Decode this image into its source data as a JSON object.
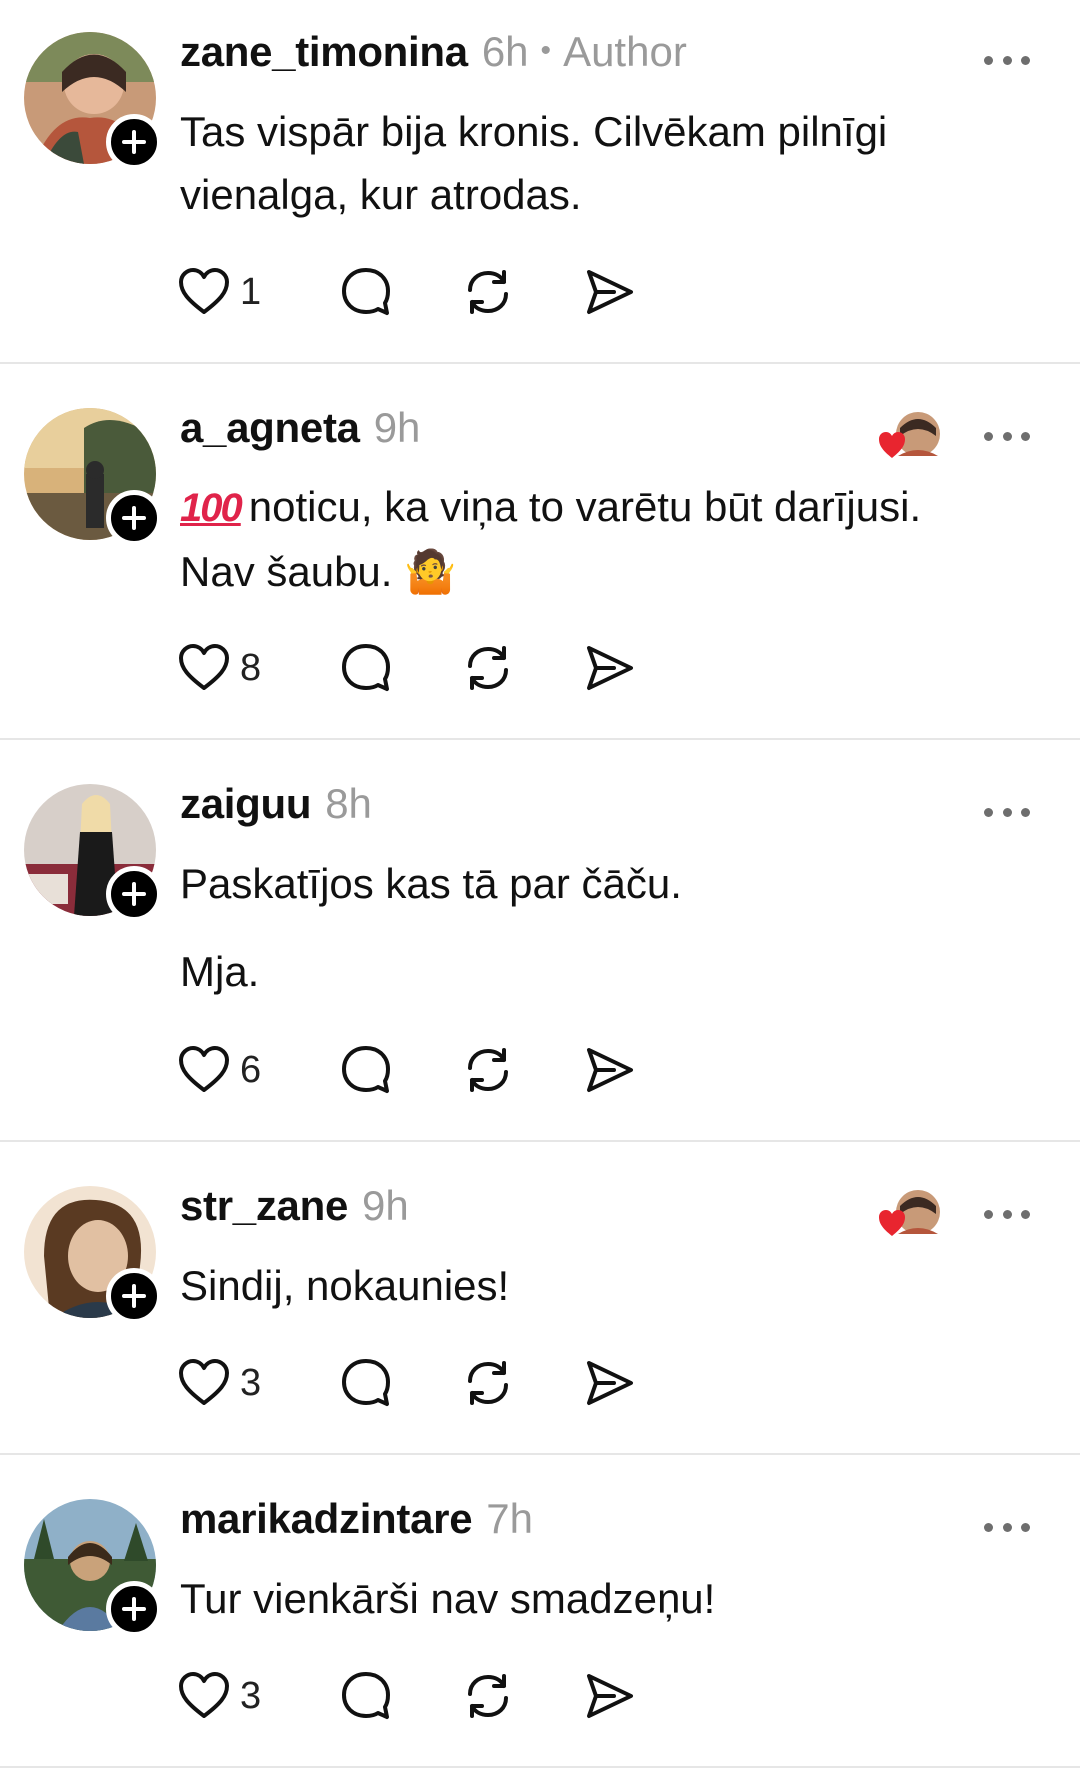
{
  "posts": [
    {
      "username": "zane_timonina",
      "time": "6h",
      "badge": "Author",
      "lines": [
        "Tas vispār bija kronis. Cilvēkam pilnīgi",
        "vienalga, kur atrodas."
      ],
      "likes": "1",
      "liked_by_author": false,
      "avatar_colors": [
        "#c89a78",
        "#3b4a3a",
        "#b5563c"
      ]
    },
    {
      "username": "a_agneta",
      "time": "9h",
      "lines": [
        "noticu, ka viņa to varētu būt darījusi.",
        "Nav šaubu."
      ],
      "prefix_emoji": "100",
      "suffix_emoji": "🤷",
      "likes": "8",
      "liked_by_author": true,
      "avatar_colors": [
        "#d8b27a",
        "#4a5a3a",
        "#2b2b2b"
      ]
    },
    {
      "username": "zaiguu",
      "time": "8h",
      "lines": [
        "Paskatījos kas tā par čāču."
      ],
      "extra_paragraph": "Mja.",
      "likes": "6",
      "liked_by_author": false,
      "avatar_colors": [
        "#d7cfc9",
        "#1a1a1a",
        "#8a2c3a"
      ]
    },
    {
      "username": "str_zane",
      "time": "9h",
      "lines": [
        "Sindij, nokaunies!"
      ],
      "likes": "3",
      "liked_by_author": true,
      "avatar_colors": [
        "#e1c0a2",
        "#5a3a22",
        "#f2e3d2"
      ]
    },
    {
      "username": "marikadzintare",
      "time": "7h",
      "lines": [
        "Tur vienkārši nav smadzeņu!"
      ],
      "likes": "3",
      "liked_by_author": false,
      "avatar_colors": [
        "#8fb0c8",
        "#3f5a35",
        "#c9a27a"
      ]
    }
  ],
  "icons": {
    "like": "heart-outline-icon",
    "reply": "speech-bubble-icon",
    "repost": "repost-arrows-icon",
    "share": "send-icon",
    "more": "more-dots-icon",
    "follow": "plus-icon",
    "liked_by": "heart-filled-icon"
  },
  "colors": {
    "text": "#111111",
    "muted": "#9a9a9a",
    "divider": "#e6e6e6",
    "like_heart": "#e8252f"
  }
}
